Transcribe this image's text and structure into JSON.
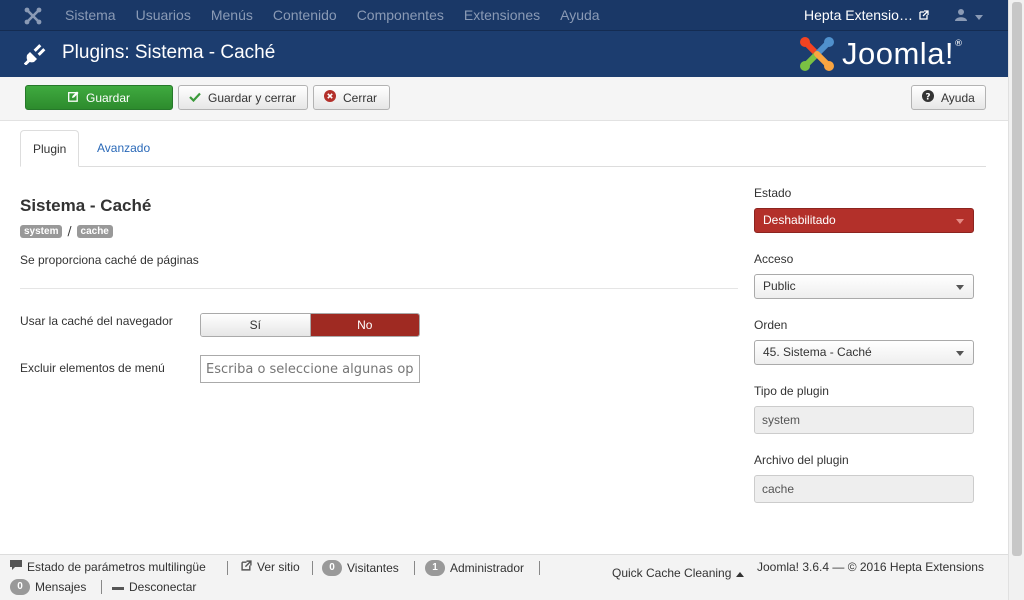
{
  "navbar": {
    "menu": [
      "Sistema",
      "Usuarios",
      "Menús",
      "Contenido",
      "Componentes",
      "Extensiones",
      "Ayuda"
    ],
    "site_name": "Hepta Extensio…"
  },
  "header": {
    "title": "Plugins: Sistema - Caché",
    "brand": "Joomla!",
    "brand_mark": "®"
  },
  "toolbar": {
    "save": "Guardar",
    "save_close": "Guardar y cerrar",
    "close": "Cerrar",
    "help": "Ayuda"
  },
  "tabs": [
    "Plugin",
    "Avanzado"
  ],
  "plugin": {
    "title": "Sistema - Caché",
    "tags": [
      "system",
      "cache"
    ],
    "tag_separator": "/",
    "description": "Se proporciona caché de páginas"
  },
  "form": {
    "browser_cache_label": "Usar la caché del navegador",
    "browser_cache_yes": "Sí",
    "browser_cache_no": "No",
    "browser_cache_value": "No",
    "exclude_label": "Excluir elementos de menú",
    "exclude_placeholder": "Escriba o seleccione algunas opciones"
  },
  "sidebar": {
    "estado_label": "Estado",
    "estado_value": "Deshabilitado",
    "acceso_label": "Acceso",
    "acceso_value": "Public",
    "orden_label": "Orden",
    "orden_value": "45. Sistema - Caché",
    "tipo_label": "Tipo de plugin",
    "tipo_value": "system",
    "archivo_label": "Archivo del plugin",
    "archivo_value": "cache"
  },
  "footer": {
    "multilang": "Estado de parámetros multilingüe",
    "view_site": "Ver sitio",
    "visitors_count": "0",
    "visitors": "Visitantes",
    "admin_count": "1",
    "admin": "Administrador",
    "quick_cache": "Quick Cache Cleaning",
    "version": "Joomla! 3.6.4 — © 2016 Hepta Extensions",
    "messages_count": "0",
    "messages": "Mensajes",
    "logout": "Desconectar"
  },
  "colors": {
    "navbar": "#1a3867",
    "header": "#1c3d6f",
    "save_green": "#2f8f2f",
    "disabled_red": "#b3302a",
    "link_blue": "#2a69b8"
  },
  "icons": [
    "joomla-icon",
    "external-link-icon",
    "user-icon",
    "plug-icon",
    "edit-icon",
    "check-icon",
    "cancel-icon",
    "help-icon",
    "comment-icon",
    "minus-icon"
  ]
}
